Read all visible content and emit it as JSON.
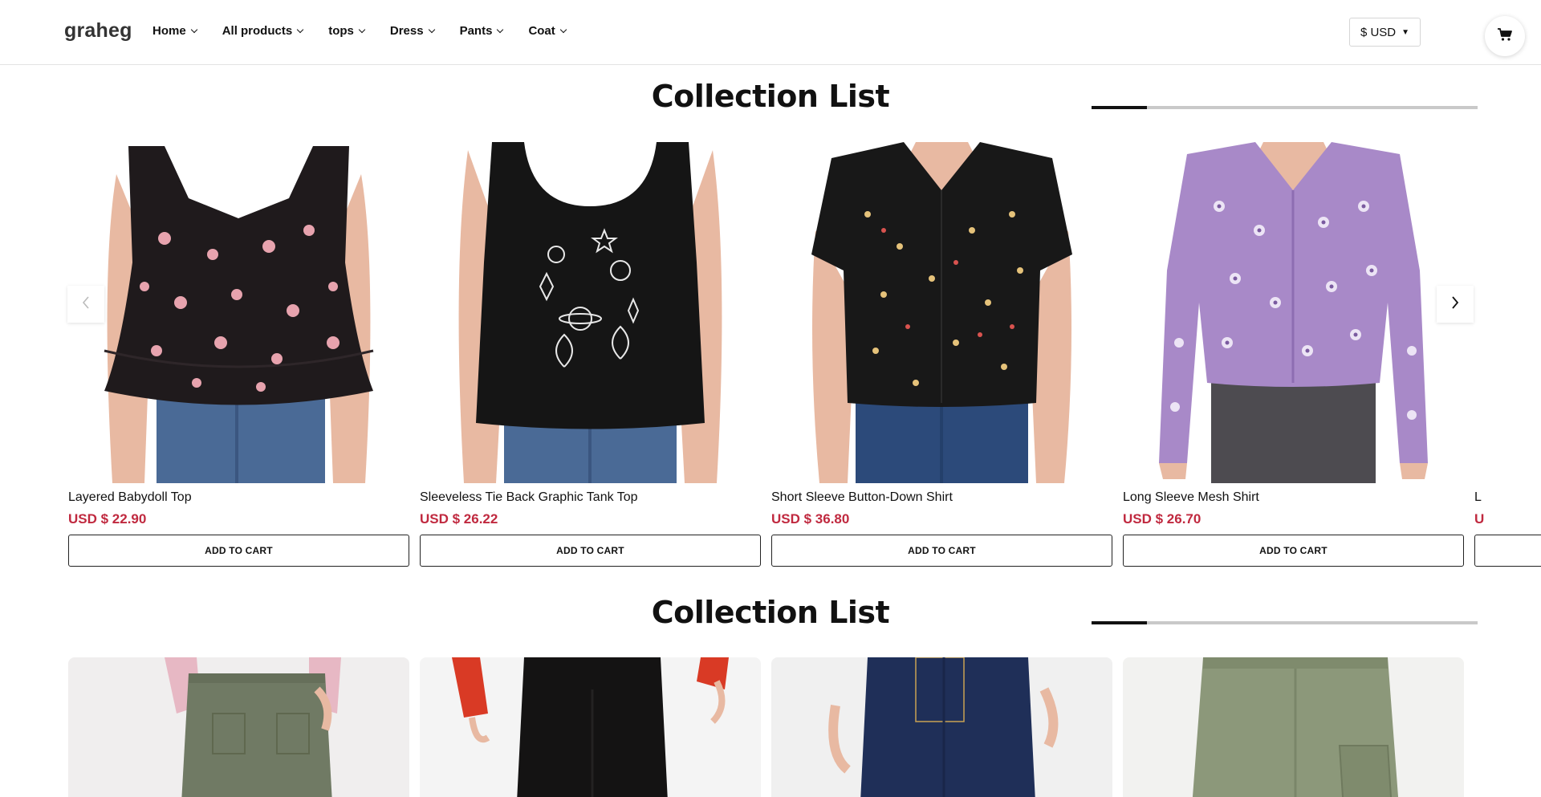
{
  "header": {
    "logo": "graheg",
    "nav": [
      {
        "label": "Home"
      },
      {
        "label": "All products"
      },
      {
        "label": "tops"
      },
      {
        "label": "Dress"
      },
      {
        "label": "Pants"
      },
      {
        "label": "Coat"
      }
    ],
    "currency": "$ USD",
    "cart_icon": "cart-icon"
  },
  "sections": [
    {
      "title": "Collection List",
      "progress": 0.144,
      "products": [
        {
          "name": "Layered Babydoll Top",
          "price": "USD $ 22.90",
          "button": "ADD TO CART"
        },
        {
          "name": "Sleeveless Tie Back Graphic Tank Top",
          "price": "USD $ 26.22",
          "button": "ADD TO CART"
        },
        {
          "name": "Short Sleeve Button-Down Shirt",
          "price": "USD $ 36.80",
          "button": "ADD TO CART"
        },
        {
          "name": "Long Sleeve Mesh Shirt",
          "price": "USD $ 26.70",
          "button": "ADD TO CART"
        },
        {
          "name": "L",
          "price": "U",
          "button": ""
        }
      ],
      "prev_icon": "chevron-left-icon",
      "next_icon": "chevron-right-icon"
    },
    {
      "title": "Collection List",
      "progress": 0.144
    }
  ],
  "colors": {
    "price": "#c0293f",
    "progress_fill": "#111111",
    "progress_track": "#c9c9c9"
  }
}
